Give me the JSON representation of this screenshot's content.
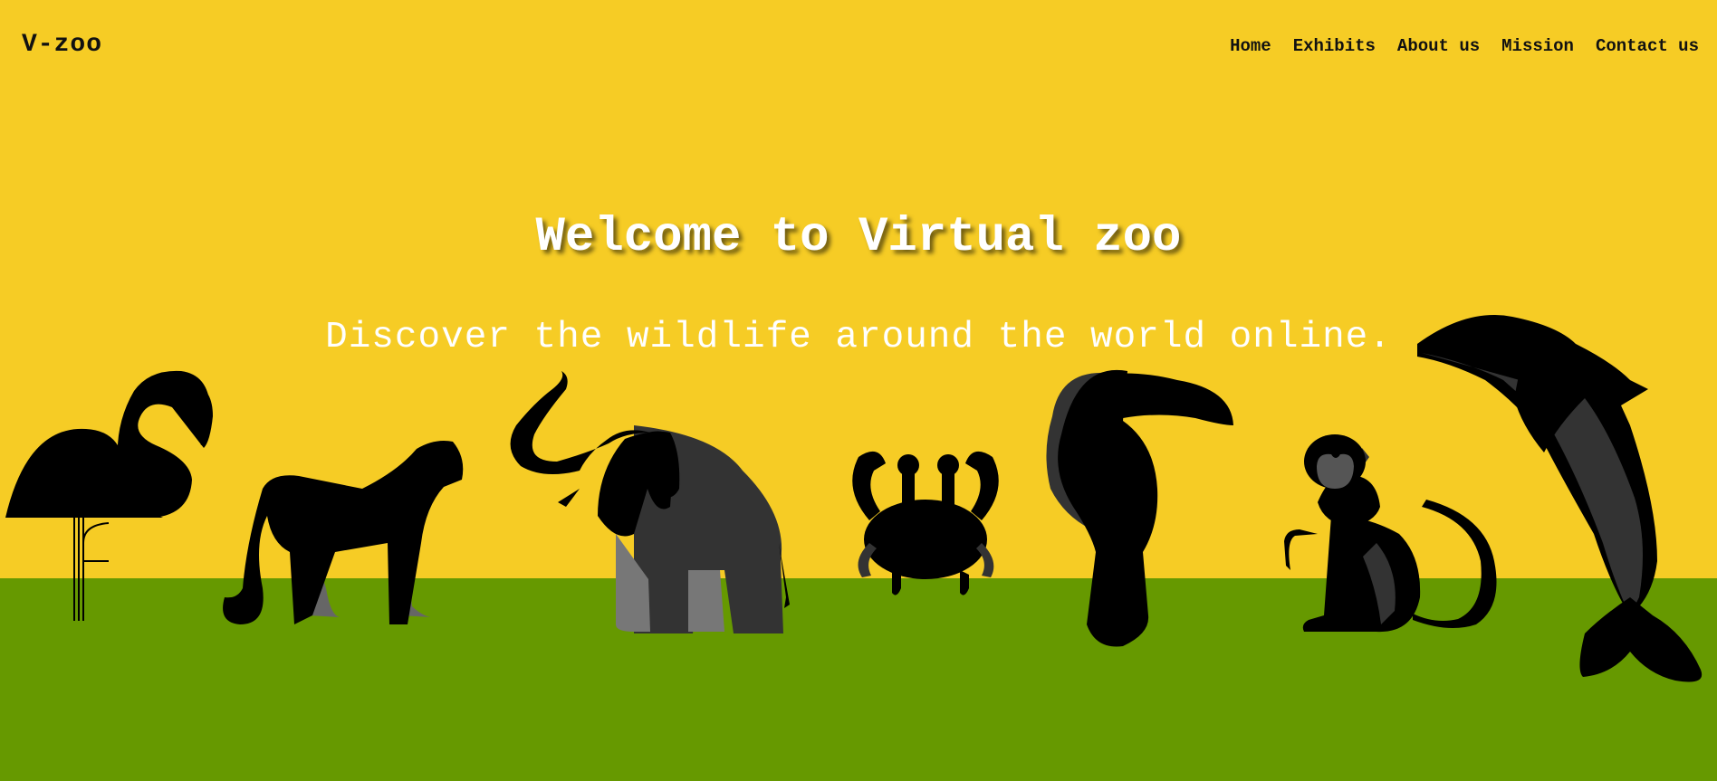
{
  "brand": {
    "logo": "V-zoo"
  },
  "nav": {
    "items": [
      "Home",
      "Exhibits",
      "About us",
      "Mission",
      "Contact us"
    ]
  },
  "hero": {
    "title": "Welcome to Virtual zoo",
    "subtitle": "Discover the wildlife around the world online."
  },
  "colors": {
    "sky": "#f6cc25",
    "grass": "#669900",
    "silhouette": "#000000",
    "shade_dark": "#333333",
    "shade_light": "#777777"
  },
  "animals": [
    "flamingo-icon",
    "cheetah-icon",
    "elephant-icon",
    "crab-icon",
    "toucan-icon",
    "monkey-icon",
    "dolphin-icon"
  ]
}
